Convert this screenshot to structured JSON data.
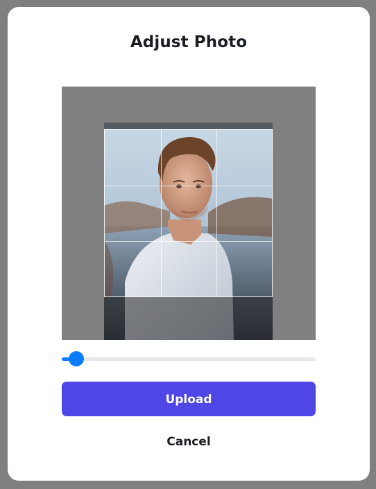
{
  "dialog": {
    "title": "Adjust Photo"
  },
  "zoom_slider": {
    "value_fraction": 0.03
  },
  "buttons": {
    "upload_label": "Upload",
    "cancel_label": "Cancel"
  },
  "colors": {
    "backdrop": "#808080",
    "primary": "#4f46e5",
    "slider_accent": "#0a7cff",
    "slider_track": "#e6e7eb"
  }
}
